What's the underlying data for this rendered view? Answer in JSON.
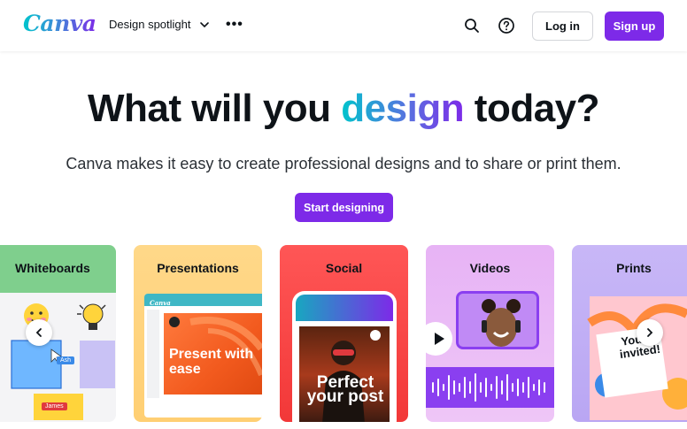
{
  "header": {
    "logo": "Canva",
    "nav_item": "Design spotlight",
    "more": "•••",
    "login_label": "Log in",
    "signup_label": "Sign up"
  },
  "hero": {
    "title_before": "What will you ",
    "title_highlight": "design",
    "title_after": " today?",
    "subtitle": "Canva makes it easy to create professional designs and to share or print them.",
    "cta_label": "Start designing"
  },
  "cards": [
    {
      "label": "Whiteboards"
    },
    {
      "label": "Presentations"
    },
    {
      "label": "Social"
    },
    {
      "label": "Videos"
    },
    {
      "label": "Prints"
    }
  ],
  "card_content": {
    "whiteboard_tag_1": "Ash",
    "whiteboard_tag_2": "James",
    "presentation_app_logo": "Canva",
    "presentation_slide_text": "Present with ease",
    "social_post_text": "Perfect your post",
    "print_card_text": "You're invited!"
  },
  "colors": {
    "brand_purple": "#7d2ae8",
    "brand_teal": "#00c4cc",
    "whiteboards": "#7fcf8d",
    "presentations": "#ffd889",
    "social": "#ff5656",
    "videos": "#e7b3f5",
    "prints": "#c8b7f7"
  },
  "icons": [
    "chevron-down-icon",
    "more-icon",
    "search-icon",
    "help-icon",
    "chevron-left-icon",
    "chevron-right-icon",
    "play-icon"
  ]
}
